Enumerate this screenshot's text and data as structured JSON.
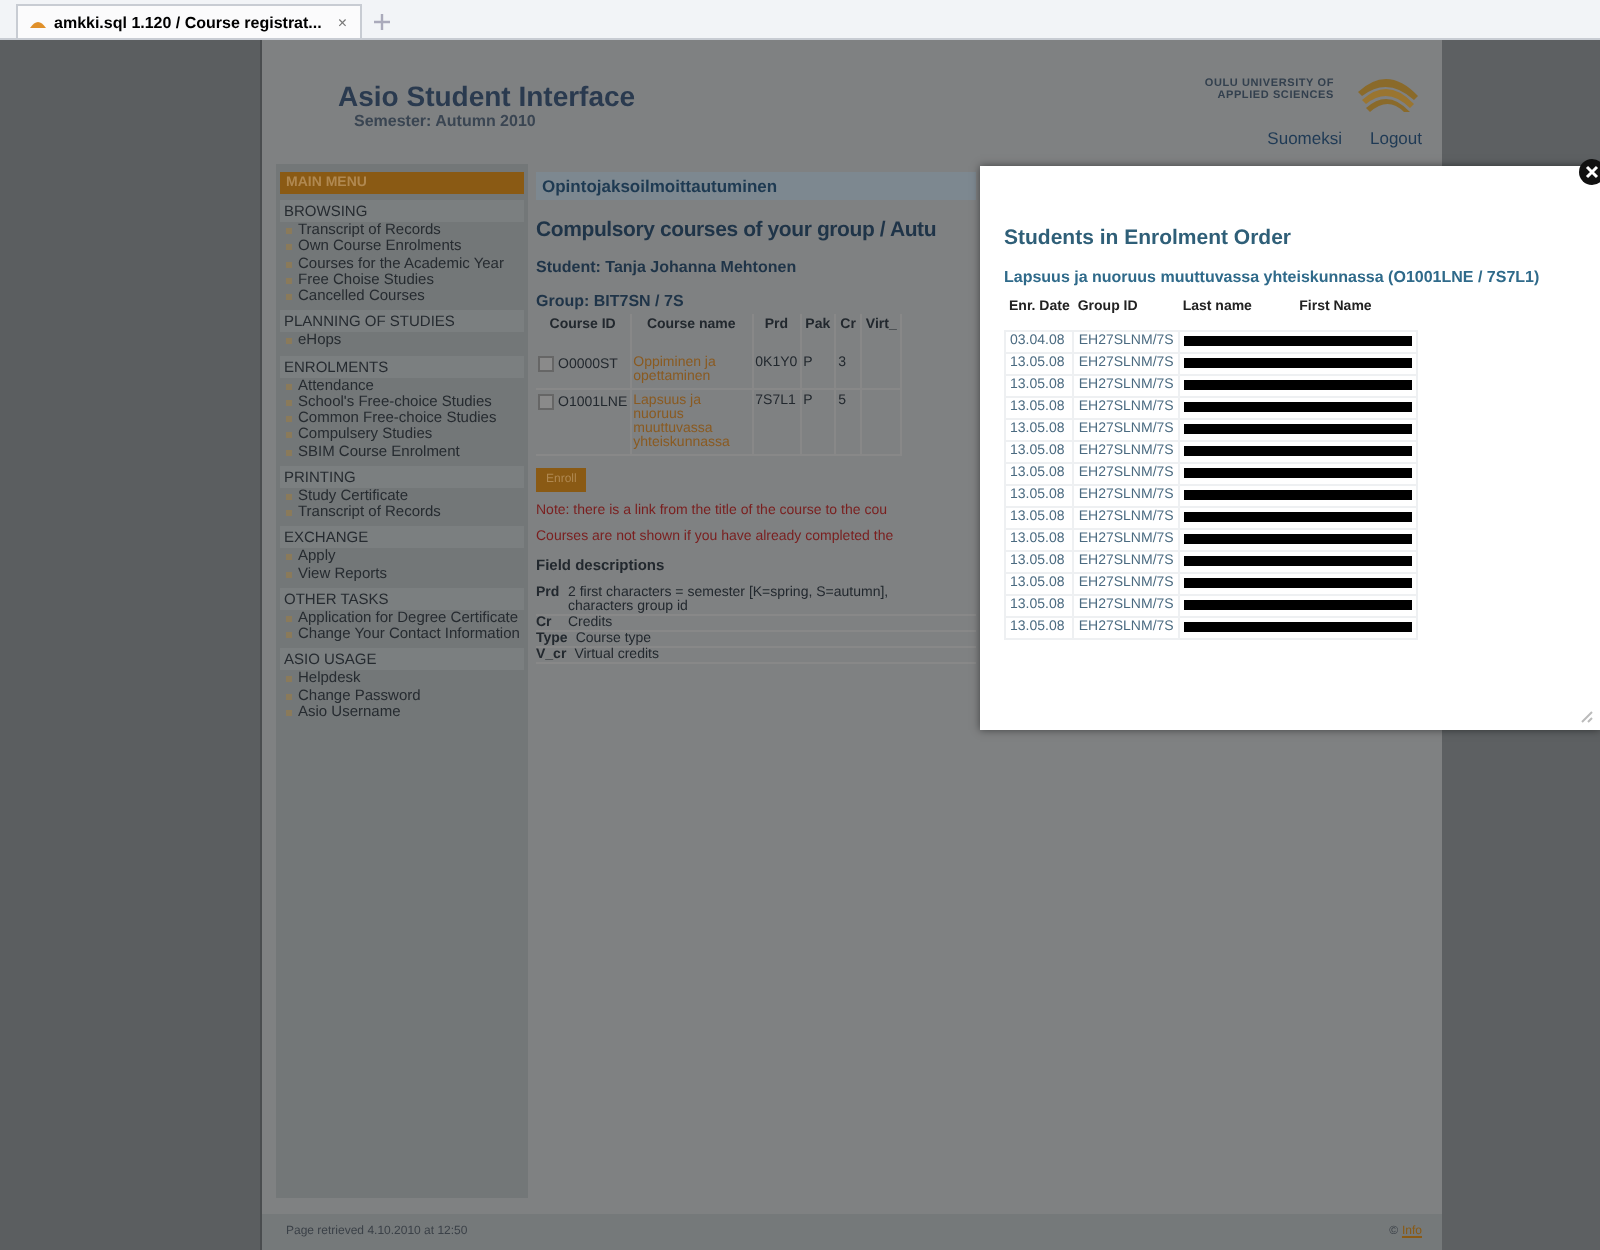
{
  "browser_tab": {
    "title": "amkki.sql 1.120 / Course registrat...",
    "close": "×"
  },
  "header": {
    "title": "Asio Student Interface",
    "subtitle": "Semester: Autumn 2010",
    "university": [
      "OULU UNIVERSITY OF",
      "APPLIED SCIENCES"
    ],
    "links": [
      "Suomeksi",
      "Logout"
    ]
  },
  "sidebar": {
    "title": "MAIN MENU",
    "sections": [
      {
        "heading": "BROWSING",
        "items": [
          "Transcript of Records",
          "Own Course Enrolments",
          "Courses for the Academic Year",
          "Free Choise Studies",
          "Cancelled Courses"
        ]
      },
      {
        "heading": "PLANNING OF STUDIES",
        "items": [
          "eHops"
        ]
      },
      {
        "heading": "ENROLMENTS",
        "items": [
          "Attendance",
          "School's Free-choice Studies",
          "Common Free-choice Studies",
          "Compulsery Studies",
          "SBIM Course Enrolment"
        ]
      },
      {
        "heading": "PRINTING",
        "items": [
          "Study Certificate",
          "Transcript of Records"
        ]
      },
      {
        "heading": "EXCHANGE",
        "items": [
          "Apply",
          "View Reports"
        ]
      },
      {
        "heading": "OTHER TASKS",
        "items": [
          "Application for Degree Certificate",
          "Change Your Contact Information"
        ]
      },
      {
        "heading": "ASIO USAGE",
        "items": [
          "Helpdesk",
          "Change Password",
          "Asio Username"
        ]
      }
    ]
  },
  "content": {
    "tab_title": "Opintojaksoilmoittautuminen",
    "heading": "Compulsory courses of your group / Autu",
    "student": "Student: Tanja Johanna Mehtonen",
    "group": "Group: BIT7SN / 7S",
    "table": {
      "columns": [
        "Course ID",
        "Course name",
        "Prd",
        "Pak",
        "Cr",
        "Virt_"
      ],
      "rows": [
        {
          "checked": false,
          "cells": [
            "O0000ST",
            "Oppiminen ja opettaminen",
            "0K1Y0",
            "P",
            "3"
          ]
        },
        {
          "checked": false,
          "cells": [
            "O1001LNE",
            "Lapsuus ja nuoruus muuttuvassa yhteiskunnassa",
            "7S7L1",
            "P",
            "5"
          ]
        }
      ]
    },
    "enroll_button": "Enroll",
    "notes": [
      "Note: there is a link from the title of the course to the cou",
      "Courses are not shown if you have already completed the"
    ],
    "field_descriptions": {
      "title": "Field descriptions",
      "items": [
        {
          "term": "Prd",
          "lines": [
            "2 first characters = semester [K=spring, S=autumn],",
            "characters group id"
          ]
        },
        {
          "term": "Cr",
          "lines": [
            "Credits"
          ]
        },
        {
          "term": "Type",
          "lines": [
            "Course type"
          ]
        },
        {
          "term": "V_cr",
          "lines": [
            "Virtual credits"
          ]
        }
      ]
    }
  },
  "modal": {
    "title": "Students in Enrolment Order",
    "course": "Lapsuus ja nuoruus muuttuvassa yhteiskunnassa (O1001LNE / 7S7L1)",
    "columns": [
      "Enr. Date",
      "Group ID",
      "Last name",
      "First Name"
    ],
    "rows": [
      {
        "date": "03.04.08",
        "group": "EH27SLNM/7S"
      },
      {
        "date": "13.05.08",
        "group": "EH27SLNM/7S"
      },
      {
        "date": "13.05.08",
        "group": "EH27SLNM/7S"
      },
      {
        "date": "13.05.08",
        "group": "EH27SLNM/7S"
      },
      {
        "date": "13.05.08",
        "group": "EH27SLNM/7S"
      },
      {
        "date": "13.05.08",
        "group": "EH27SLNM/7S"
      },
      {
        "date": "13.05.08",
        "group": "EH27SLNM/7S"
      },
      {
        "date": "13.05.08",
        "group": "EH27SLNM/7S"
      },
      {
        "date": "13.05.08",
        "group": "EH27SLNM/7S"
      },
      {
        "date": "13.05.08",
        "group": "EH27SLNM/7S"
      },
      {
        "date": "13.05.08",
        "group": "EH27SLNM/7S"
      },
      {
        "date": "13.05.08",
        "group": "EH27SLNM/7S"
      },
      {
        "date": "13.05.08",
        "group": "EH27SLNM/7S"
      },
      {
        "date": "13.05.08",
        "group": "EH27SLNM/7S"
      }
    ]
  },
  "footer": {
    "retrieved": "Page retrieved 4.10.2010 at 12:50",
    "copyright": "©",
    "link": "Info"
  }
}
